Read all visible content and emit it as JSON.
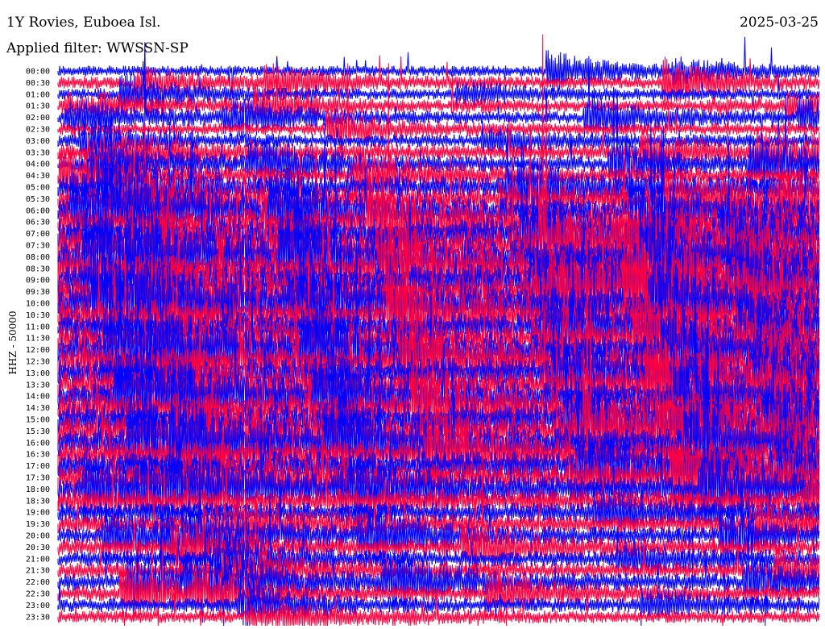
{
  "header": {
    "station": "1Y Rovies, Euboea Isl.",
    "filter": "Applied filter: WWSSN-SP",
    "date": "2025-03-25"
  },
  "chart_data": {
    "type": "line",
    "title": "1Y Rovies, Euboea Isl.",
    "subtitle": "Applied filter: WWSSN-SP",
    "date": "2025-03-25",
    "ylabel": "HHZ - 50000",
    "xlabel": "",
    "grid": false,
    "row_labels": [
      "00:00",
      "00:30",
      "01:00",
      "01:30",
      "02:00",
      "02:30",
      "03:00",
      "03:30",
      "04:00",
      "04:30",
      "05:00",
      "05:30",
      "06:00",
      "06:30",
      "07:00",
      "07:30",
      "08:00",
      "08:30",
      "09:00",
      "09:30",
      "10:00",
      "10:30",
      "11:00",
      "11:30",
      "12:00",
      "12:30",
      "13:00",
      "13:30",
      "14:00",
      "14:30",
      "15:00",
      "15:30",
      "16:00",
      "16:30",
      "17:00",
      "17:30",
      "18:00",
      "18:30",
      "19:00",
      "19:30",
      "20:00",
      "20:30",
      "21:00",
      "21:30",
      "22:00",
      "22:30",
      "23:00",
      "23:30"
    ],
    "series_colors": [
      "#0000ff",
      "#ff0040"
    ],
    "relative_activity": [
      0.15,
      0.2,
      0.15,
      0.15,
      0.2,
      0.2,
      0.2,
      0.3,
      0.3,
      0.35,
      0.5,
      0.55,
      0.6,
      0.75,
      0.8,
      0.8,
      0.85,
      0.85,
      0.85,
      0.85,
      0.8,
      0.8,
      0.7,
      0.7,
      0.75,
      0.8,
      0.75,
      0.7,
      0.7,
      0.75,
      0.8,
      0.75,
      0.75,
      0.7,
      0.7,
      0.65,
      0.6,
      0.55,
      0.45,
      0.4,
      0.35,
      0.35,
      0.3,
      0.3,
      0.35,
      0.3,
      0.25,
      0.2
    ]
  }
}
